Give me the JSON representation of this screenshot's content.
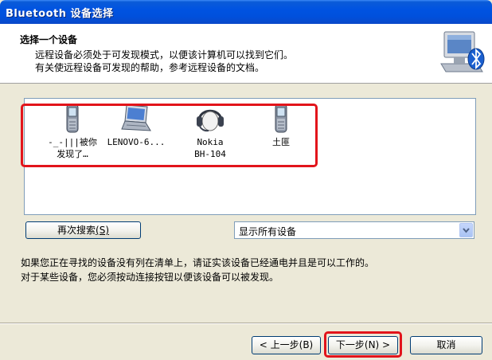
{
  "window": {
    "title": "Bluetooth 设备选择"
  },
  "header": {
    "title": "选择一个设备",
    "line1": "远程设备必须处于可发现模式，以便该计算机可以找到它们。",
    "line2": "有关使远程设备可发现的帮助，参考远程设备的文档。",
    "icon": "bluetooth-computer-icon"
  },
  "devices": [
    {
      "line1": "-_-|||被你",
      "line2": "发现了…",
      "icon": "mobile-phone-icon"
    },
    {
      "line1": "LENOVO-6...",
      "line2": "",
      "icon": "laptop-icon"
    },
    {
      "line1": "Nokia",
      "line2": "BH-104",
      "icon": "headset-icon"
    },
    {
      "line1": "土匪",
      "line2": "",
      "icon": "mobile-phone-icon"
    }
  ],
  "search_button": {
    "label": "再次搜索",
    "mnemonic": "(S)"
  },
  "filter": {
    "selected": "显示所有设备",
    "icon": "chevron-down-icon"
  },
  "info": {
    "line1": "如果您正在寻找的设备没有列在清单上，请证实该设备已经通电并且是可以工作的。",
    "line2": "对于某些设备，您必须按动连接按钮以便该设备可以被发现。"
  },
  "buttons": {
    "back": "< 上一步(B)",
    "next": "下一步(N) >",
    "cancel": "取消"
  },
  "colors": {
    "highlight": "#e2141b",
    "titlebar": "#0053e1"
  }
}
